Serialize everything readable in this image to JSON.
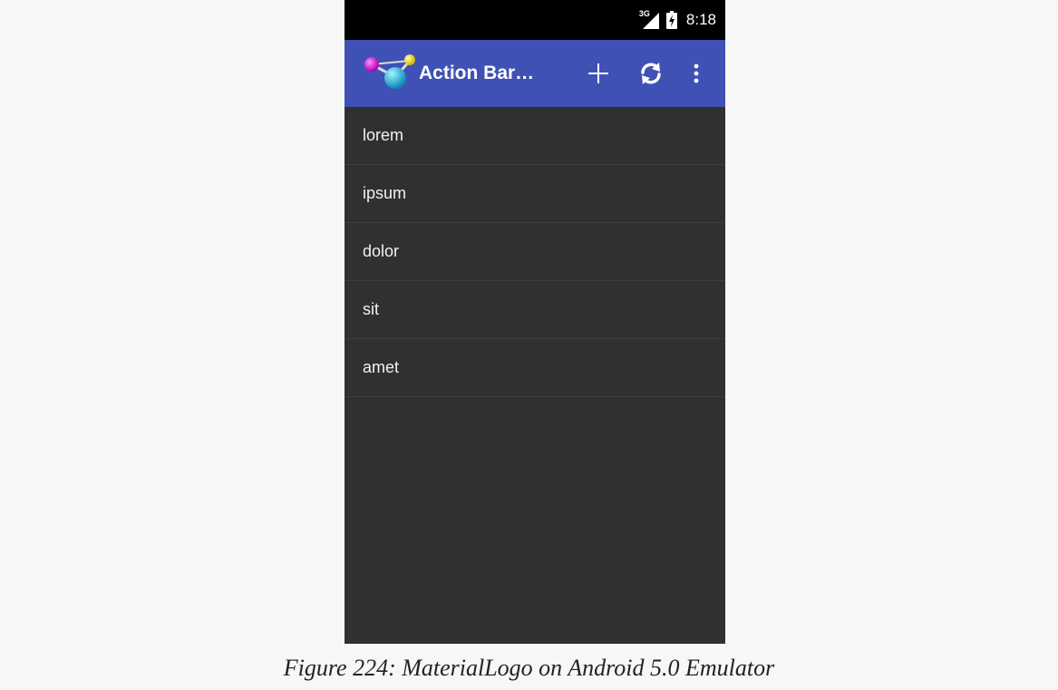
{
  "status_bar": {
    "network_label": "3G",
    "time": "8:18"
  },
  "action_bar": {
    "logo_icon": "molecule-logo-icon",
    "title": "Action Bar…",
    "actions": [
      {
        "name": "add",
        "icon": "plus-icon"
      },
      {
        "name": "refresh",
        "icon": "refresh-icon"
      },
      {
        "name": "overflow",
        "icon": "more-vert-icon"
      }
    ],
    "color": "#3f51b5"
  },
  "list": {
    "items": [
      "lorem",
      "ipsum",
      "dolor",
      "sit",
      "amet"
    ]
  },
  "caption": "Figure 224: MaterialLogo on Android 5.0 Emulator",
  "colors": {
    "background": "#303030",
    "status_bar": "#000000",
    "page": "#f7f7f7"
  }
}
